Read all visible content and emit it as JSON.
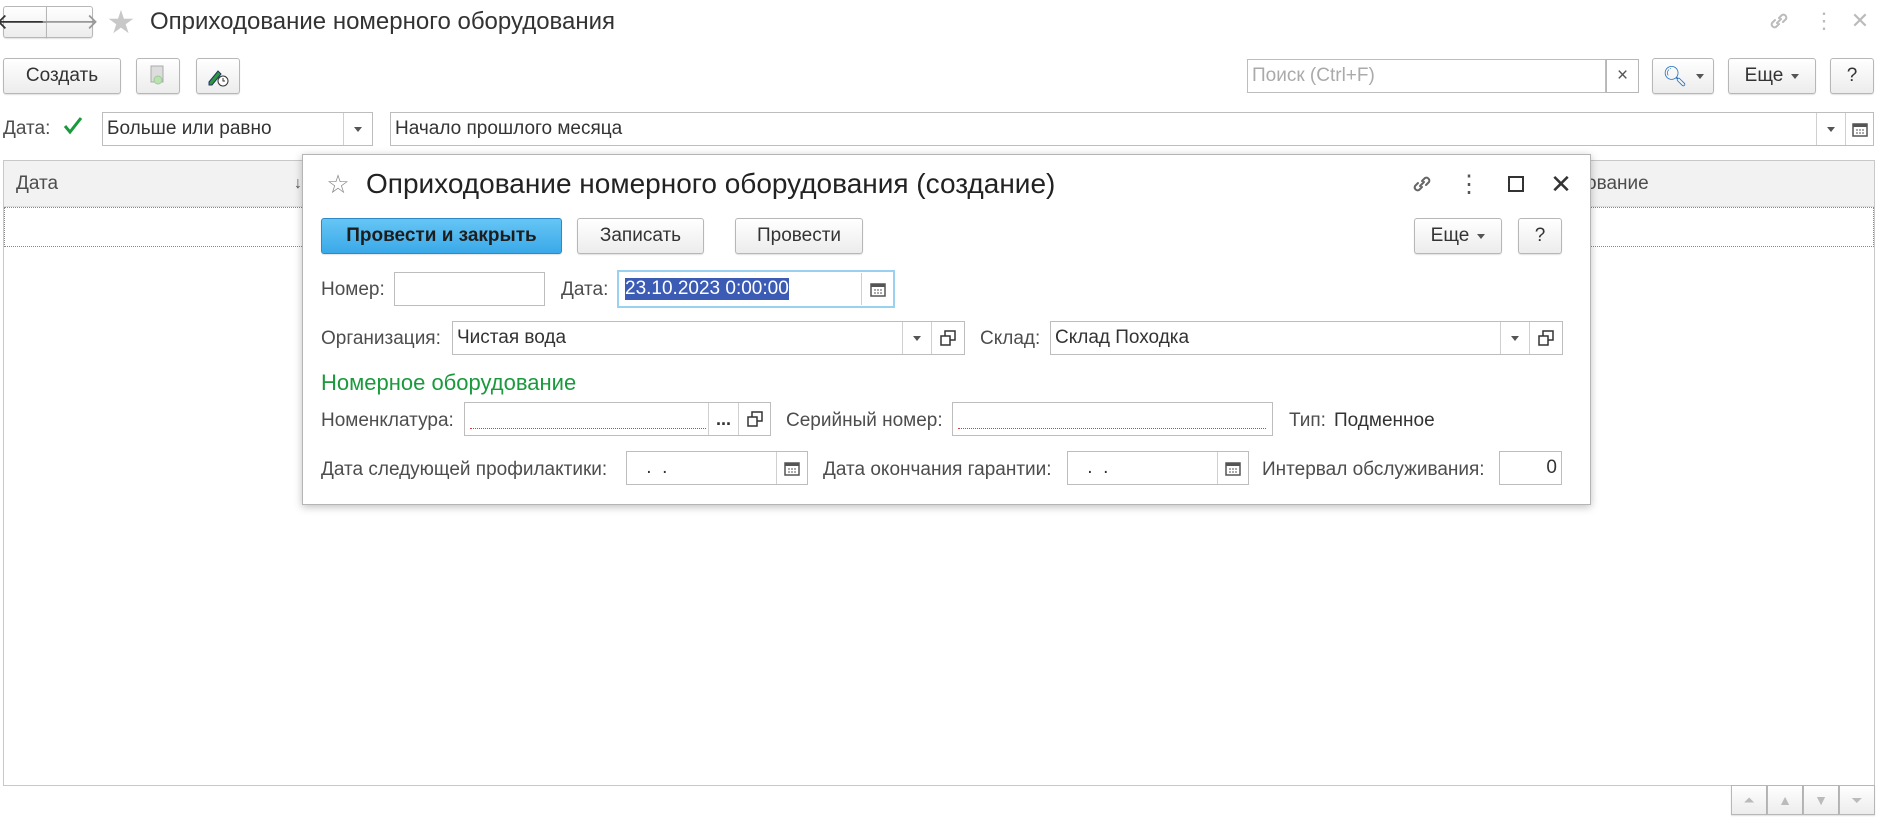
{
  "main_window": {
    "title": "Оприходование номерного оборудования",
    "toolbar": {
      "create_label": "Создать",
      "search_placeholder": "Поиск (Ctrl+F)",
      "clear_label": "×",
      "more_label": "Еще",
      "help_label": "?"
    },
    "filter": {
      "label": "Дата:",
      "checked": true,
      "condition": "Больше или равно",
      "value": "Начало прошлого месяца"
    },
    "table": {
      "columns": [
        "Дата",
        "ование"
      ]
    }
  },
  "dialog": {
    "title": "Оприходование номерного оборудования (создание)",
    "buttons": {
      "post_close": "Провести и закрыть",
      "save": "Записать",
      "post": "Провести",
      "more": "Еще",
      "help": "?"
    },
    "fields": {
      "number_label": "Номер:",
      "number_value": "",
      "date_label": "Дата:",
      "date_value": "23.10.2023  0:00:00",
      "org_label": "Организация:",
      "org_value": "Чистая вода",
      "warehouse_label": "Склад:",
      "warehouse_value": "Склад Походка"
    },
    "section": {
      "title": "Номерное оборудование",
      "nomenclature_label": "Номенклатура:",
      "nomenclature_value": "",
      "ellipsis": "...",
      "serial_label": "Серийный номер:",
      "serial_value": "",
      "type_label": "Тип:",
      "type_value": "Подменное",
      "next_maint_label": "Дата следующей профилактики:",
      "next_maint_value": " .  .",
      "warranty_label": "Дата окончания гарантии:",
      "warranty_value": " .  .",
      "interval_label": "Интервал обслуживания:",
      "interval_value": "0"
    }
  },
  "colors": {
    "accent": "#3aa9e8",
    "section_green": "#1a9a3c",
    "check_green": "#1a9a3c"
  }
}
